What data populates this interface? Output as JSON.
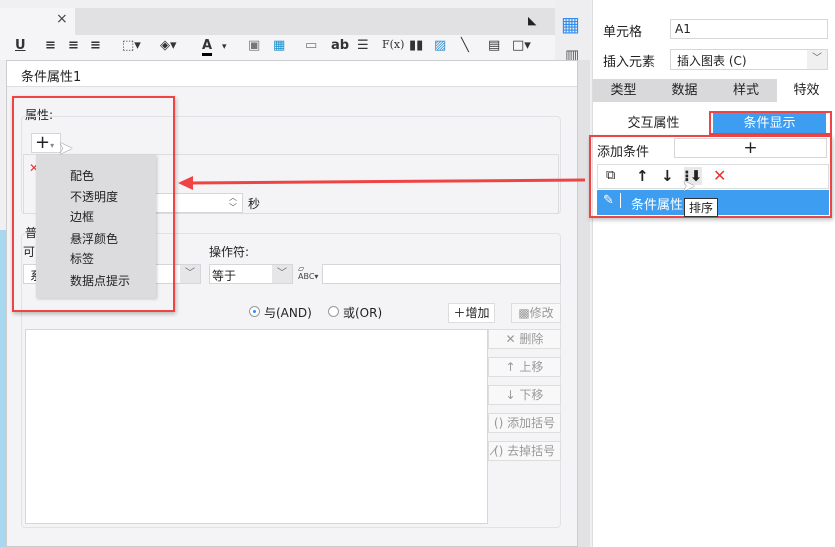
{
  "tab": {
    "close": "×"
  },
  "toolbar": {
    "icons": [
      "underline-icon",
      "align-left-icon",
      "align-center-icon",
      "align-right-icon",
      "border-icon",
      "fill-color-icon",
      "font-color-icon",
      "merge-icon",
      "table-icon",
      "textfield-icon",
      "text-icon",
      "paragraph-icon",
      "formula-icon",
      "chart-icon",
      "image-icon",
      "slash-icon",
      "subreport-icon",
      "frame-icon"
    ],
    "labels": {
      "underline": "U",
      "text": "ab",
      "formula": "F(x)",
      "font_color": "A"
    }
  },
  "dialog": {
    "title": "条件属性1",
    "property_label": "属性:",
    "add_symbol": "+",
    "seconds_unit": "秒",
    "menu": [
      "配色",
      "不透明度",
      "边框",
      "悬浮颜色",
      "标签",
      "数据点提示"
    ],
    "normal_label": "普",
    "column_label": "可",
    "column_value": "系",
    "operator_label": "操作符:",
    "operator_value": "等于",
    "value_input": "",
    "and_label": "与(AND)",
    "or_label": "或(OR)",
    "selected_logic": "AND",
    "add_label": "增加",
    "modify_label": "修改",
    "side_buttons": [
      "删除",
      "上移",
      "下移",
      "添加括号",
      "去掉括号"
    ]
  },
  "right": {
    "cell_label": "单元格",
    "cell_value": "A1",
    "insert_label": "插入元素",
    "insert_value": "插入图表 (C)",
    "tabs": [
      "类型",
      "数据",
      "样式",
      "特效"
    ],
    "active_tab": "特效",
    "subtabs": [
      "交互属性",
      "条件显示"
    ],
    "active_subtab": "条件显示",
    "add_condition": "添加条件",
    "add_symbol": "+",
    "condition_item": "条件属性1",
    "tooltip": "排序"
  },
  "colors": {
    "accent": "#3d9df0",
    "highlight": "#ee4444"
  }
}
